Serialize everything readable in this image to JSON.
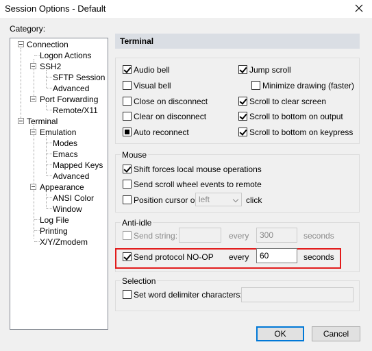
{
  "window": {
    "title": "Session Options - Default",
    "close_icon": "close-icon"
  },
  "category_label": "Category:",
  "tree": {
    "connection": "Connection",
    "logon_actions": "Logon Actions",
    "ssh2": "SSH2",
    "sftp_session": "SFTP Session",
    "ssh2_advanced": "Advanced",
    "port_forwarding": "Port Forwarding",
    "remote_x11": "Remote/X11",
    "terminal": "Terminal",
    "emulation": "Emulation",
    "modes": "Modes",
    "emacs": "Emacs",
    "mapped_keys": "Mapped Keys",
    "emulation_advanced": "Advanced",
    "appearance": "Appearance",
    "ansi_color": "ANSI Color",
    "window": "Window",
    "log_file": "Log File",
    "printing": "Printing",
    "xyzmodem": "X/Y/Zmodem"
  },
  "section": {
    "title": "Terminal"
  },
  "terminal_options": {
    "audio_bell": {
      "label": "Audio bell",
      "checked": true
    },
    "visual_bell": {
      "label": "Visual bell",
      "checked": false
    },
    "close_on_disconnect": {
      "label": "Close on disconnect",
      "checked": false
    },
    "clear_on_disconnect": {
      "label": "Clear on disconnect",
      "checked": false
    },
    "auto_reconnect": {
      "label": "Auto reconnect",
      "checked": true
    },
    "jump_scroll": {
      "label": "Jump scroll",
      "checked": true
    },
    "minimize_drawing": {
      "label": "Minimize drawing (faster)",
      "checked": false
    },
    "scroll_to_clear": {
      "label": "Scroll to clear screen",
      "checked": true
    },
    "scroll_bottom_output": {
      "label": "Scroll to bottom on output",
      "checked": true
    },
    "scroll_bottom_keypress": {
      "label": "Scroll to bottom on keypress",
      "checked": true
    }
  },
  "mouse": {
    "title": "Mouse",
    "shift_forces": {
      "label": "Shift forces local mouse operations",
      "checked": true
    },
    "scroll_wheel": {
      "label": "Send scroll wheel events to remote",
      "checked": false
    },
    "position_cursor": {
      "label": "Position cursor on",
      "checked": false
    },
    "position_value": "left",
    "click_label": "click"
  },
  "anti_idle": {
    "title": "Anti-idle",
    "send_string": {
      "label": "Send string:",
      "checked": false,
      "value": ""
    },
    "every_label": "every",
    "string_interval": "300",
    "seconds_label": "seconds",
    "send_noop": {
      "label": "Send protocol NO-OP",
      "checked": true
    },
    "noop_every_label": "every",
    "noop_interval": "60",
    "noop_seconds_label": "seconds"
  },
  "selection": {
    "title": "Selection",
    "word_delim": {
      "label": "Set word delimiter characters:",
      "checked": false,
      "value": ""
    }
  },
  "buttons": {
    "ok": "OK",
    "cancel": "Cancel"
  },
  "colors": {
    "highlight": "#e21b1b",
    "default_button_border": "#0078d7",
    "section_header_bg": "#dadee4"
  }
}
